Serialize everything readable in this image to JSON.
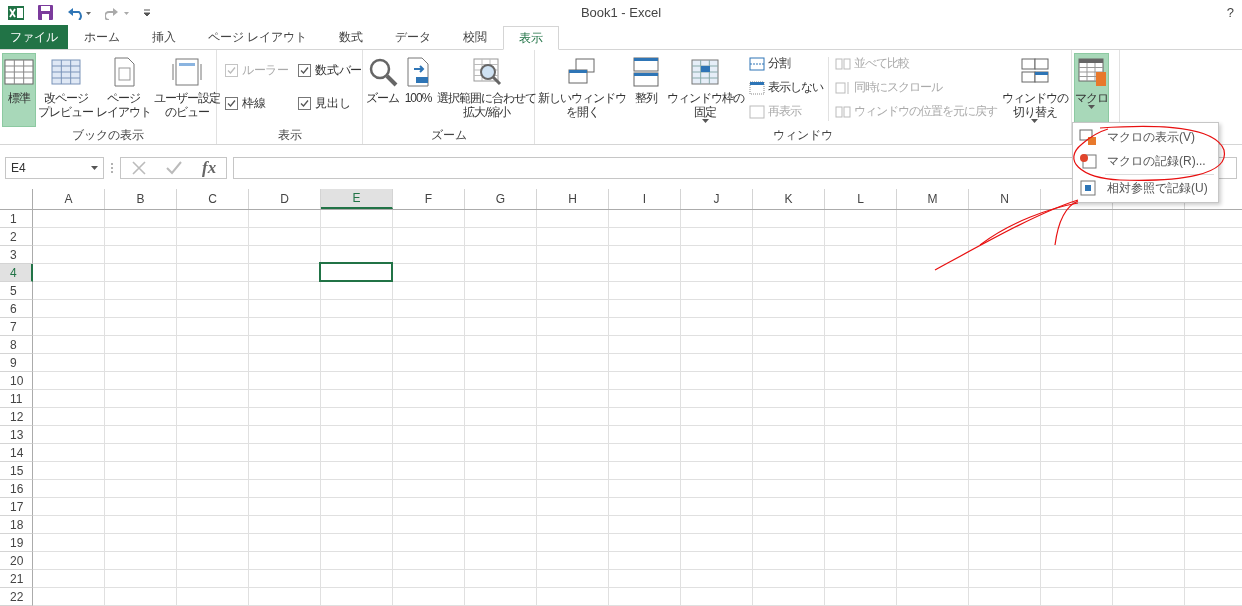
{
  "title_bar": {
    "title": "Book1 - Excel",
    "help": "?"
  },
  "tabs": [
    {
      "label": "ファイル",
      "kind": "file",
      "selected": false
    },
    {
      "label": "ホーム",
      "kind": "tab",
      "selected": false
    },
    {
      "label": "挿入",
      "kind": "tab",
      "selected": false
    },
    {
      "label": "ページ レイアウト",
      "kind": "tab",
      "selected": false
    },
    {
      "label": "数式",
      "kind": "tab",
      "selected": false
    },
    {
      "label": "データ",
      "kind": "tab",
      "selected": false
    },
    {
      "label": "校閲",
      "kind": "tab",
      "selected": false
    },
    {
      "label": "表示",
      "kind": "tab",
      "selected": true
    }
  ],
  "ribbon_groups": [
    {
      "label": "ブックの表示",
      "items": [
        {
          "kind": "large",
          "label_lines": [
            "標準"
          ],
          "selected": true,
          "dropdown": false
        },
        {
          "kind": "large",
          "label_lines": [
            "改ページ",
            "プレビュー"
          ],
          "selected": false,
          "dropdown": false
        },
        {
          "kind": "large",
          "label_lines": [
            "ページ",
            "レイアウト"
          ],
          "selected": false,
          "dropdown": false
        },
        {
          "kind": "large",
          "label_lines": [
            "ユーザー設定",
            "のビュー"
          ],
          "selected": false,
          "dropdown": false
        }
      ]
    },
    {
      "label": "表示",
      "items": [
        {
          "kind": "checks",
          "items": [
            {
              "label": "ルーラー",
              "checked": true,
              "disabled": true
            },
            {
              "label": "数式バー",
              "checked": true,
              "disabled": false
            },
            {
              "label": "枠線",
              "checked": true,
              "disabled": false
            },
            {
              "label": "見出し",
              "checked": true,
              "disabled": false
            }
          ]
        }
      ]
    },
    {
      "label": "ズーム",
      "items": [
        {
          "kind": "large",
          "label_lines": [
            "ズーム"
          ],
          "selected": false,
          "dropdown": false
        },
        {
          "kind": "large",
          "label_lines": [
            "100%"
          ],
          "selected": false,
          "dropdown": false
        },
        {
          "kind": "large",
          "label_lines": [
            "選択範囲に合わせて",
            "拡大/縮小"
          ],
          "selected": false,
          "dropdown": false
        }
      ]
    },
    {
      "label": "ウィンドウ",
      "items": [
        {
          "kind": "large",
          "label_lines": [
            "新しいウィンドウ",
            "を開く"
          ],
          "selected": false,
          "dropdown": false
        },
        {
          "kind": "large",
          "label_lines": [
            "整列"
          ],
          "selected": false,
          "dropdown": false
        },
        {
          "kind": "large",
          "label_lines": [
            "ウィンドウ枠の",
            "固定"
          ],
          "selected": false,
          "dropdown": true
        },
        {
          "kind": "stack",
          "items": [
            {
              "label": "分割",
              "disabled": false
            },
            {
              "label": "表示しない",
              "disabled": false
            },
            {
              "label": "再表示",
              "disabled": true
            }
          ]
        },
        {
          "kind": "stack",
          "items": [
            {
              "label": "並べて比較",
              "disabled": true
            },
            {
              "label": "同時にスクロール",
              "disabled": true
            },
            {
              "label": "ウィンドウの位置を元に戻す",
              "disabled": true
            }
          ]
        },
        {
          "kind": "large",
          "label_lines": [
            "ウィンドウの",
            "切り替え"
          ],
          "selected": false,
          "dropdown": true
        }
      ]
    },
    {
      "items": [
        {
          "kind": "large",
          "label_lines": [
            "マクロ"
          ],
          "selected": true,
          "dropdown": true
        }
      ]
    }
  ],
  "formula_bar": {
    "name_box": "E4",
    "fx": "fx"
  },
  "columns": [
    {
      "label": "A",
      "selected": false
    },
    {
      "label": "B",
      "selected": false
    },
    {
      "label": "C",
      "selected": false
    },
    {
      "label": "D",
      "selected": false
    },
    {
      "label": "E",
      "selected": true
    },
    {
      "label": "F",
      "selected": false
    },
    {
      "label": "G",
      "selected": false
    },
    {
      "label": "H",
      "selected": false
    },
    {
      "label": "I",
      "selected": false
    },
    {
      "label": "J",
      "selected": false
    },
    {
      "label": "K",
      "selected": false
    },
    {
      "label": "L",
      "selected": false
    },
    {
      "label": "M",
      "selected": false
    },
    {
      "label": "N",
      "selected": false
    }
  ],
  "rows": [
    {
      "label": "1",
      "selected": false
    },
    {
      "label": "2",
      "selected": false
    },
    {
      "label": "3",
      "selected": false
    },
    {
      "label": "4",
      "selected": true
    },
    {
      "label": "5",
      "selected": false
    },
    {
      "label": "6",
      "selected": false
    },
    {
      "label": "7",
      "selected": false
    },
    {
      "label": "8",
      "selected": false
    },
    {
      "label": "9",
      "selected": false
    },
    {
      "label": "10",
      "selected": false
    },
    {
      "label": "11",
      "selected": false
    },
    {
      "label": "12",
      "selected": false
    },
    {
      "label": "13",
      "selected": false
    },
    {
      "label": "14",
      "selected": false
    },
    {
      "label": "15",
      "selected": false
    },
    {
      "label": "16",
      "selected": false
    },
    {
      "label": "17",
      "selected": false
    },
    {
      "label": "18",
      "selected": false
    },
    {
      "label": "19",
      "selected": false
    },
    {
      "label": "20",
      "selected": false
    },
    {
      "label": "21",
      "selected": false
    },
    {
      "label": "22",
      "selected": false
    }
  ],
  "macro_menu": [
    {
      "label": "マクロの表示(V)",
      "separator_before": false
    },
    {
      "label": "マクロの記録(R)...",
      "separator_before": false
    },
    {
      "label": "相対参照で記録(U)",
      "separator_before": true
    }
  ]
}
